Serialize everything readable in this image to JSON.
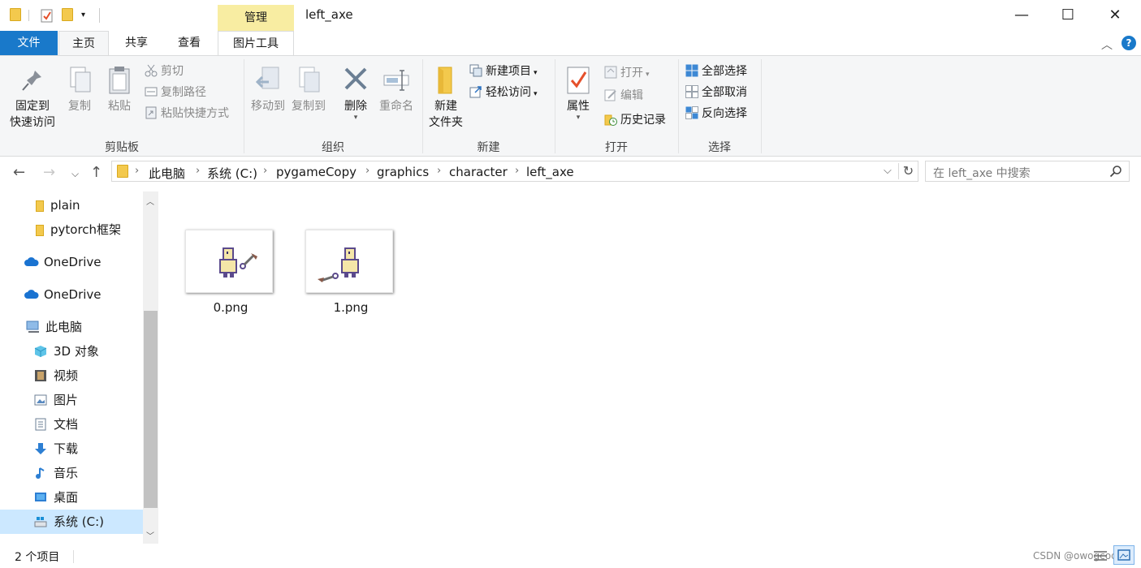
{
  "window": {
    "title": "left_axe",
    "context_tab": "管理",
    "minimize": "—",
    "maximize": "☐",
    "close": "✕"
  },
  "tabs": {
    "file": "文件",
    "home": "主页",
    "share": "共享",
    "view": "查看",
    "picture_tools": "图片工具"
  },
  "ribbon": {
    "clipboard": {
      "group": "剪贴板",
      "pin_line1": "固定到",
      "pin_line2": "快速访问",
      "copy": "复制",
      "paste": "粘贴",
      "cut": "剪切",
      "copy_path": "复制路径",
      "paste_shortcut": "粘贴快捷方式"
    },
    "organize": {
      "group": "组织",
      "move_to": "移动到",
      "copy_to": "复制到",
      "delete": "删除",
      "rename": "重命名"
    },
    "new": {
      "group": "新建",
      "new_folder_line1": "新建",
      "new_folder_line2": "文件夹",
      "new_item": "新建项目",
      "easy_access": "轻松访问"
    },
    "open": {
      "group": "打开",
      "properties": "属性",
      "open": "打开",
      "edit": "编辑",
      "history": "历史记录"
    },
    "select": {
      "group": "选择",
      "select_all": "全部选择",
      "select_none": "全部取消",
      "invert": "反向选择"
    }
  },
  "address": {
    "crumbs": [
      "此电脑",
      "系统 (C:)",
      "pygameCopy",
      "graphics",
      "character",
      "left_axe"
    ],
    "search_placeholder": "在 left_axe 中搜索"
  },
  "nav_pane": {
    "items": [
      "plain",
      "pytorch框架",
      "OneDrive",
      "OneDrive",
      "此电脑",
      "3D 对象",
      "视频",
      "图片",
      "文档",
      "下载",
      "音乐",
      "桌面",
      "系统 (C:)"
    ]
  },
  "files": [
    {
      "name": "0.png"
    },
    {
      "name": "1.png"
    }
  ],
  "status": {
    "count": "2 个项目",
    "watermark": "CSDN @owogcode"
  },
  "colors": {
    "accent": "#1979ca",
    "context_tab": "#f8eda2",
    "folder": "#f3c94d",
    "selected": "#cce8ff"
  }
}
